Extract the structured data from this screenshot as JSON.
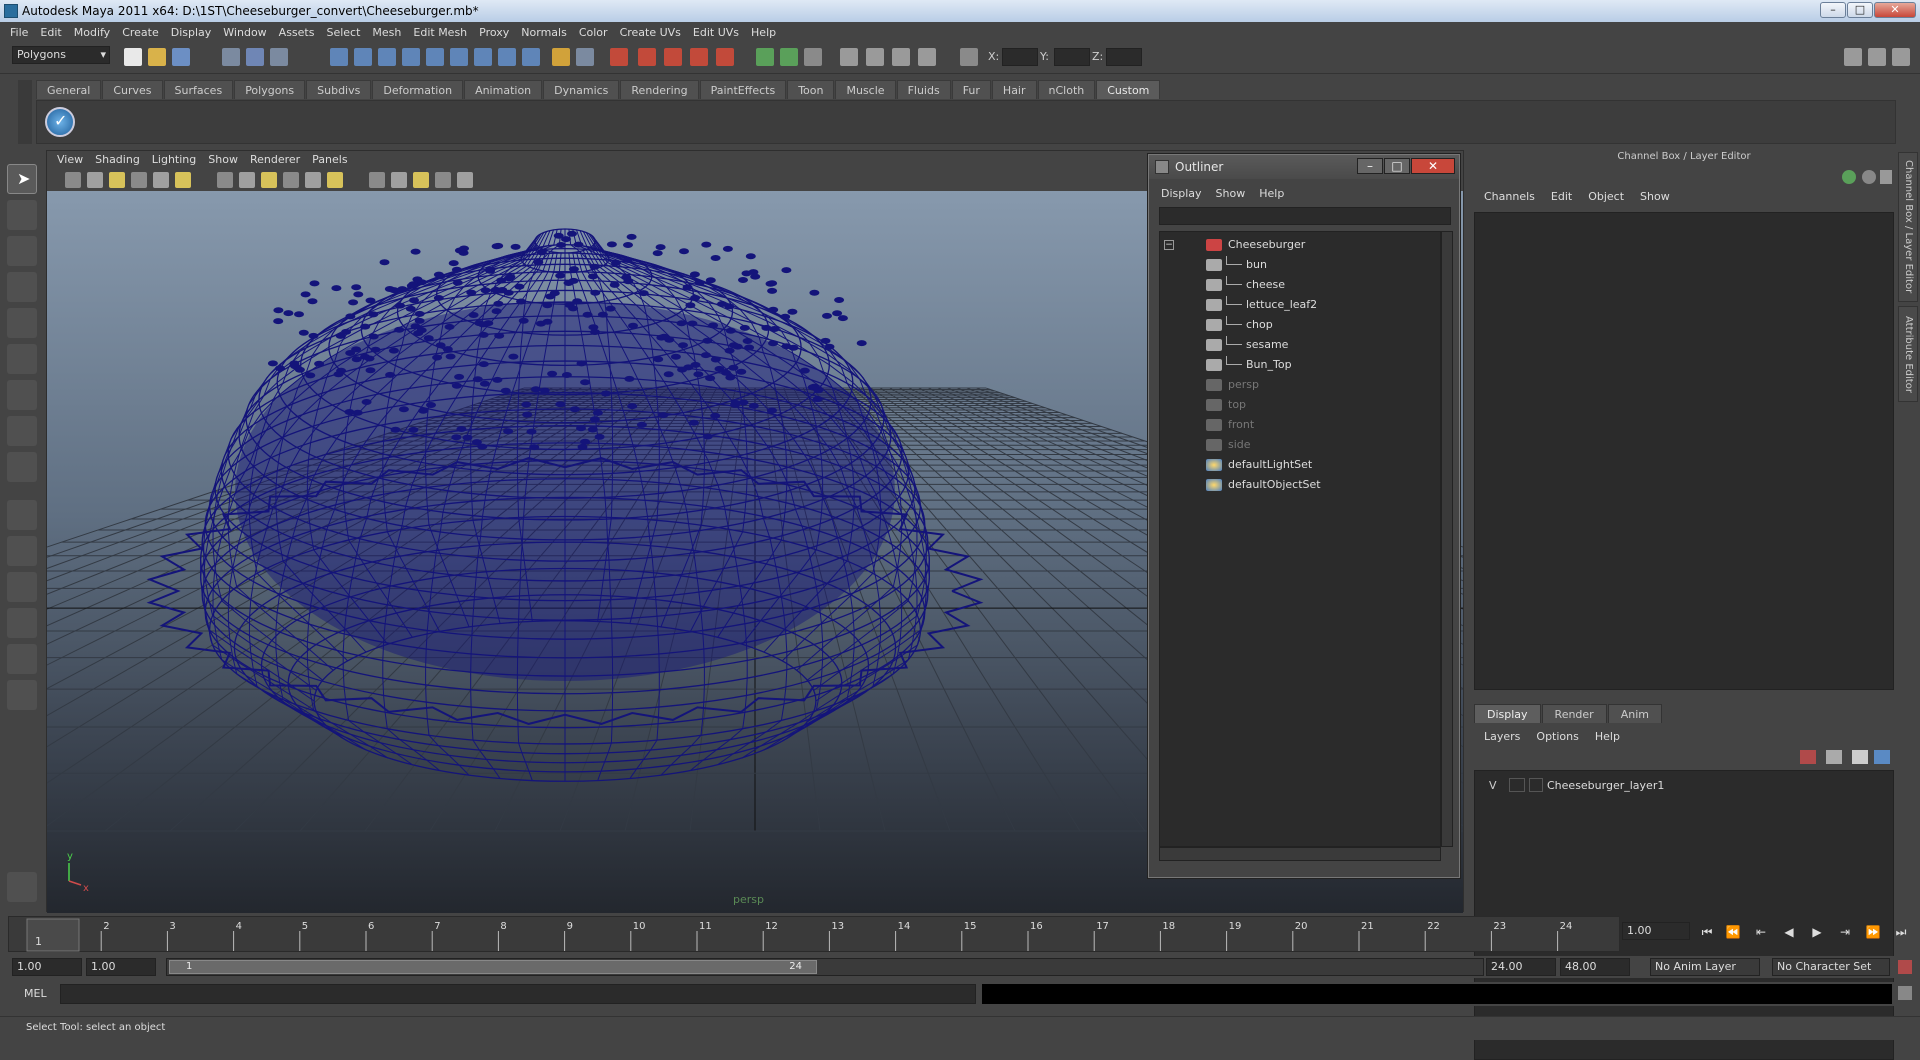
{
  "window": {
    "title": "Autodesk Maya 2011 x64: D:\\1ST\\Cheeseburger_convert\\Cheeseburger.mb*"
  },
  "menubar": [
    "File",
    "Edit",
    "Modify",
    "Create",
    "Display",
    "Window",
    "Assets",
    "Select",
    "Mesh",
    "Edit Mesh",
    "Proxy",
    "Normals",
    "Color",
    "Create UVs",
    "Edit UVs",
    "Help"
  ],
  "status_line": {
    "mode": "Polygons",
    "x_label": "X:",
    "y_label": "Y:",
    "z_label": "Z:"
  },
  "shelf_tabs": [
    "General",
    "Curves",
    "Surfaces",
    "Polygons",
    "Subdivs",
    "Deformation",
    "Animation",
    "Dynamics",
    "Rendering",
    "PaintEffects",
    "Toon",
    "Muscle",
    "Fluids",
    "Fur",
    "Hair",
    "nCloth",
    "Custom"
  ],
  "shelf_active": "Custom",
  "viewport": {
    "menu": [
      "View",
      "Shading",
      "Lighting",
      "Show",
      "Renderer",
      "Panels"
    ],
    "camera_label": "persp",
    "wire_color": "#14147a"
  },
  "outliner": {
    "title": "Outliner",
    "menu": [
      "Display",
      "Show",
      "Help"
    ],
    "items": [
      {
        "label": "Cheeseburger",
        "level": 0,
        "dim": false,
        "icon": "transform-icon"
      },
      {
        "label": "bun",
        "level": 1,
        "dim": false,
        "icon": "mesh-icon"
      },
      {
        "label": "cheese",
        "level": 1,
        "dim": false,
        "icon": "mesh-icon"
      },
      {
        "label": "lettuce_leaf2",
        "level": 1,
        "dim": false,
        "icon": "mesh-icon"
      },
      {
        "label": "chop",
        "level": 1,
        "dim": false,
        "icon": "mesh-icon"
      },
      {
        "label": "sesame",
        "level": 1,
        "dim": false,
        "icon": "mesh-icon"
      },
      {
        "label": "Bun_Top",
        "level": 1,
        "dim": false,
        "icon": "mesh-icon"
      },
      {
        "label": "persp",
        "level": 0,
        "dim": true,
        "icon": "camera-icon"
      },
      {
        "label": "top",
        "level": 0,
        "dim": true,
        "icon": "camera-icon"
      },
      {
        "label": "front",
        "level": 0,
        "dim": true,
        "icon": "camera-icon"
      },
      {
        "label": "side",
        "level": 0,
        "dim": true,
        "icon": "camera-icon"
      },
      {
        "label": "defaultLightSet",
        "level": 0,
        "dim": false,
        "icon": "set-icon"
      },
      {
        "label": "defaultObjectSet",
        "level": 0,
        "dim": false,
        "icon": "set-icon"
      }
    ]
  },
  "channel_box": {
    "title": "Channel Box / Layer Editor",
    "menu": [
      "Channels",
      "Edit",
      "Object",
      "Show"
    ],
    "layer_tabs": [
      "Display",
      "Render",
      "Anim"
    ],
    "layer_active": "Display",
    "layer_menu": [
      "Layers",
      "Options",
      "Help"
    ],
    "layers": [
      {
        "visible": "V",
        "name": "Cheeseburger_layer1"
      }
    ],
    "side_tabs": [
      "Channel Box / Layer Editor",
      "Attribute Editor"
    ]
  },
  "timeline": {
    "ticks": [
      "1",
      "2",
      "3",
      "4",
      "5",
      "6",
      "7",
      "8",
      "9",
      "10",
      "11",
      "12",
      "13",
      "14",
      "15",
      "16",
      "17",
      "18",
      "19",
      "20",
      "21",
      "22",
      "23",
      "24"
    ],
    "current_marker": "1",
    "current_time": "1.00"
  },
  "range": {
    "start_anim": "1.00",
    "start_play": "1.00",
    "slider_start": "1",
    "slider_end": "24",
    "end_play": "24.00",
    "end_anim": "48.00",
    "anim_layer": "No Anim Layer",
    "character_set": "No Character Set"
  },
  "command_line": {
    "label": "MEL"
  },
  "help_line": {
    "text": "Select Tool: select an object"
  }
}
